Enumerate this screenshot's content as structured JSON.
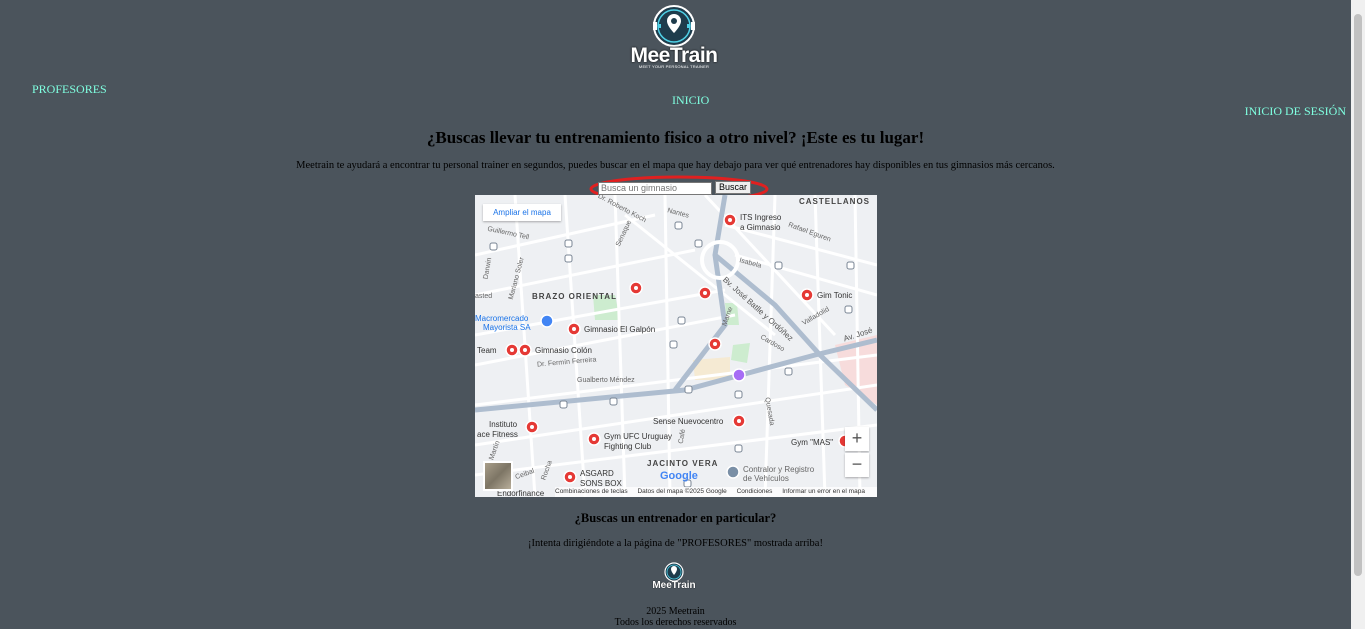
{
  "brand": {
    "name": "MeeTrain",
    "tagline": "MEET YOUR PERSONAL TRAINER"
  },
  "nav": {
    "profesores": "PROFESORES",
    "inicio": "INICIO",
    "login": "INICIO DE SESIÓN"
  },
  "hero": {
    "title": "¿Buscas llevar tu entrenamiento fisico a otro nivel? ¡Este es tu lugar!",
    "description": "Meetrain te ayudará a encontrar tu personal trainer en segundos, puedes buscar en el mapa que hay debajo para ver qué entrenadores hay disponibles en tus gimnasios más cercanos."
  },
  "search": {
    "placeholder": "Busca un gimnasio",
    "button": "Buscar"
  },
  "map": {
    "expand_label": "Ampliar el mapa",
    "zoom_in": "+",
    "zoom_out": "−",
    "google": "Google",
    "footer": {
      "shortcuts": "Combinaciones de teclas",
      "data": "Datos del mapa ©2025 Google",
      "terms": "Condiciones",
      "report": "Informar un error en el mapa"
    },
    "labels": {
      "castellanos": "CASTELLANOS",
      "brazo": "BRAZO ORIENTAL",
      "jacinto": "JACINTO VERA",
      "its": "ITS Ingreso",
      "its2": "a Gimnasio",
      "tonic": "Gim Tonic",
      "galpon": "Gimnasio El Galpón",
      "colon": "Gimnasio Colón",
      "team": "Team",
      "macro": "Macromercado",
      "macro2": "Mayorista SA",
      "sense": "Sense Nuevocentro",
      "ufc": "Gym UFC Uruguay",
      "ufc2": "Fighting Club",
      "instituto": "Instituto",
      "instituto2": "ace Fitness",
      "mas": "Gym \"MAS\"",
      "asgard": "ASGARD",
      "asgard2": "SONS BOX",
      "contralor": "Contralor y Registro",
      "contralor2": "de Vehículos",
      "endor": "Endorfinance",
      "batlle": "Bv. José Batlle y Ordóñez",
      "nantes": "Nantes",
      "koch": "Dr. Roberto Koch",
      "tell": "Guillermo Tell",
      "eguren": "Rafael Eguren",
      "isabela": "Isabela",
      "darwin": "Darwin",
      "soler": "Mariano Soler",
      "ferreira": "Dr. Fermín Ferreira",
      "mendez": "Gualberto Méndez",
      "cardoso": "Cardoso",
      "valladolid": "Valladolid",
      "avjose": "Av. José",
      "quesada": "Quesada",
      "senaque": "Senaque",
      "marne": "Marne",
      "cafe": "Café",
      "cebal": "Ceibal",
      "rocha": "Rocha",
      "martin": "Martín",
      "lastedt": "asted"
    }
  },
  "trainer": {
    "title": "¿Buscas un entrenador en particular?",
    "tip": "¡Intenta dirigiéndote a la página de \"PROFESORES\" mostrada arriba!"
  },
  "footer": {
    "year": "2025 Meetrain",
    "rights": "Todos los derechos reservados"
  },
  "colors": {
    "background": "#4b545c",
    "nav_link": "#7fffe0",
    "highlight": "#e02020",
    "marker": "#e53935"
  }
}
